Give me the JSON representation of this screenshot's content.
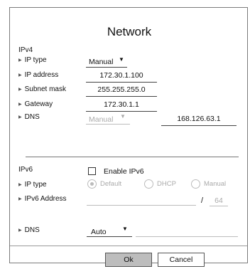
{
  "title": "Network",
  "ipv4": {
    "section": "IPv4",
    "ip_type_label": "IP type",
    "ip_type_value": "Manual",
    "ip_address_label": "IP address",
    "ip_address_value": "172.30.1.100",
    "subnet_mask_label": "Subnet mask",
    "subnet_mask_value": "255.255.255.0",
    "gateway_label": "Gateway",
    "gateway_value": "172.30.1.1",
    "dns_label": "DNS",
    "dns_mode_value": "Manual",
    "dns_value": "168.126.63.1"
  },
  "ipv6": {
    "section": "IPv6",
    "enable_label": "Enable IPv6",
    "enable_checked": false,
    "ip_type_label": "IP type",
    "ip_type_options": [
      "Default",
      "DHCP",
      "Manual"
    ],
    "ip_type_selected": "Default",
    "ipv6_address_label": "IPv6 Address",
    "ipv6_address_value": "",
    "prefix_separator": "/",
    "prefix_value": "64",
    "dns_label": "DNS",
    "dns_mode_value": "Auto",
    "dns_value": ""
  },
  "buttons": {
    "ok": "Ok",
    "cancel": "Cancel"
  },
  "colors": {
    "ok_button_bg": "#bdbdbd",
    "cancel_button_bg": "#ffffff",
    "border": "#7a7a7a",
    "disabled_text": "#aaaaaa"
  }
}
